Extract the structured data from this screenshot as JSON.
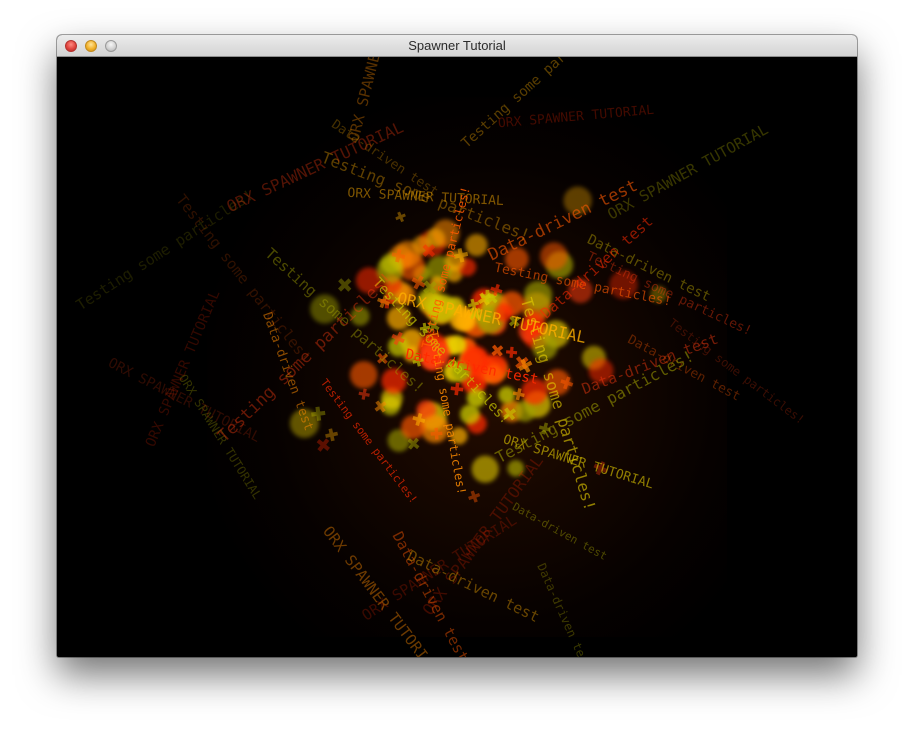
{
  "window": {
    "title": "Spawner Tutorial"
  },
  "particle_text": [
    "Testing some particles!",
    "ORX SPAWNER TUTORIAL",
    "Data-driven test",
    "Data-driven test",
    "Testing some particles!",
    "ORX SPAWNER TUTORIAL",
    "Testing some particles!",
    "Data-driven test",
    "ORX SPAWNER TUTORIAL",
    "Testing some particles!",
    "Data-driven test",
    "ORX SPAWNER TUTORIAL",
    "Testing some particles!",
    "Data-driven test",
    "ORX SPAWNER TUTORIAL",
    "Testing some particles!",
    "Testing some particles!",
    "Data-driven test",
    "ORX SPAWNER TUTORIAL",
    "Testing some particles!",
    "ORX SPAWNER TUTORIAL",
    "Data-driven test",
    "Testing some particles!",
    "ORX SPAWNER TUTORIAL",
    "Data-driven test",
    "Testing some particles!",
    "ORX SPAWNER TUTORIAL",
    "Data-driven test",
    "Testing some particles!",
    "ORX SPAWNER TUTORIAL",
    "Testing some particles!",
    "Data-driven test",
    "ORX SPAWNER TUTORIAL",
    "Testing some particles!",
    "Data-driven test",
    "ORX SPAWNER TUTORIAL",
    "Testing some particles!",
    "Data-driven test",
    "ORX SPAWNER TUTORIAL",
    "Testing some particles!"
  ],
  "particle_colors": [
    "#ff2a00",
    "#ff5a00",
    "#ff8c00",
    "#ffb000",
    "#e8d000",
    "#c8c800",
    "#a0a000",
    "#ff3c10"
  ]
}
